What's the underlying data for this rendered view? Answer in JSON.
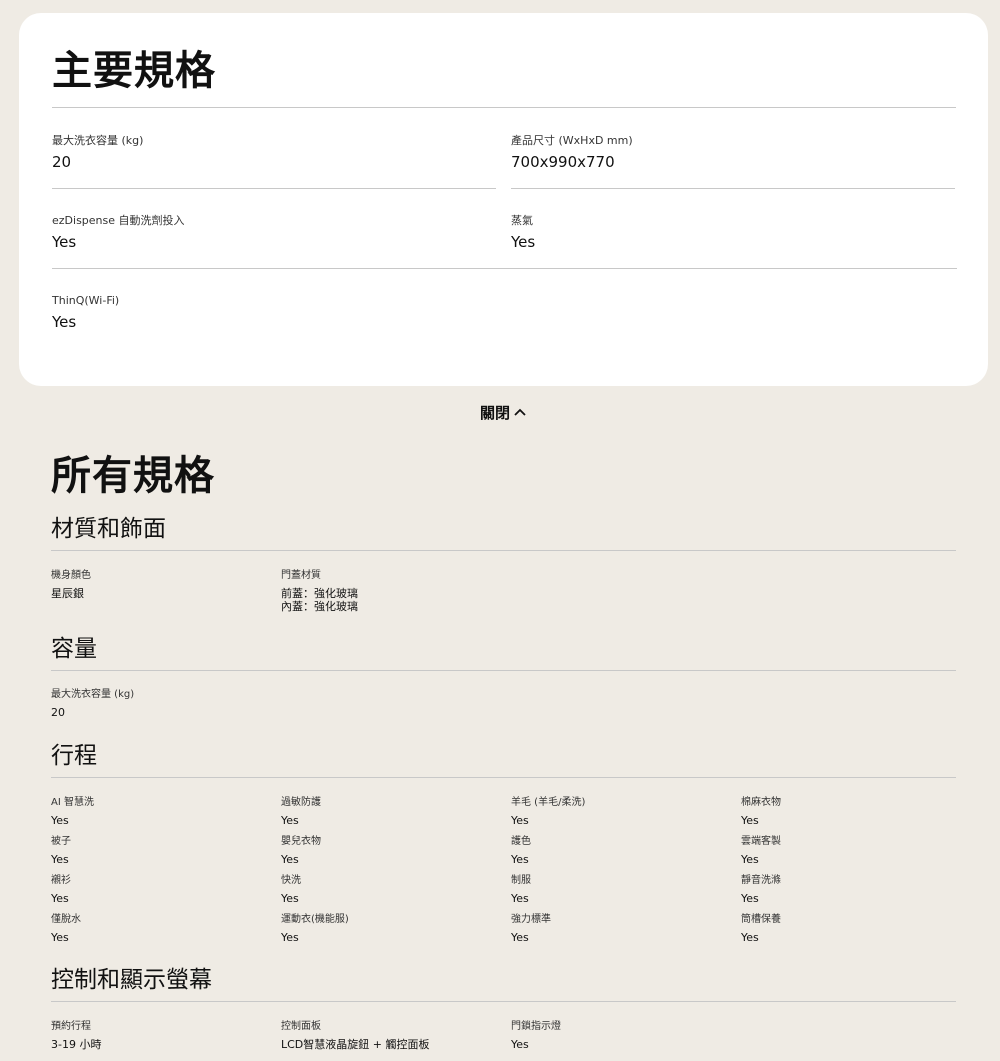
{
  "key_specs": {
    "title": "主要規格",
    "items": [
      {
        "label": "最大洗衣容量 (kg)",
        "value": "20"
      },
      {
        "label": "產品尺寸 (WxHxD mm)",
        "value": "700x990x770"
      },
      {
        "label": "ezDispense 自動洗劑投入",
        "value": "Yes"
      },
      {
        "label": "蒸氣",
        "value": "Yes"
      },
      {
        "label": "ThinQ(Wi-Fi)",
        "value": "Yes"
      }
    ]
  },
  "toggle": {
    "label": "關閉",
    "icon": "chevron-up-icon"
  },
  "all_specs": {
    "title": "所有規格",
    "sections": [
      {
        "title": "材質和飾面",
        "items": [
          {
            "label": "機身顏色",
            "value": "星辰銀"
          },
          {
            "label": "門蓋材質",
            "value": "前蓋：強化玻璃\n內蓋：強化玻璃"
          }
        ]
      },
      {
        "title": "容量",
        "items": [
          {
            "label": "最大洗衣容量 (kg)",
            "value": "20"
          }
        ]
      },
      {
        "title": "行程",
        "items": [
          {
            "label": "AI 智慧洗",
            "value": "Yes"
          },
          {
            "label": "過敏防護",
            "value": "Yes"
          },
          {
            "label": "羊毛 (羊毛/柔洗)",
            "value": "Yes"
          },
          {
            "label": "棉麻衣物",
            "value": "Yes"
          },
          {
            "label": "被子",
            "value": "Yes"
          },
          {
            "label": "嬰兒衣物",
            "value": "Yes"
          },
          {
            "label": "護色",
            "value": "Yes"
          },
          {
            "label": "雲端客製",
            "value": "Yes"
          },
          {
            "label": "襯衫",
            "value": "Yes"
          },
          {
            "label": "快洗",
            "value": "Yes"
          },
          {
            "label": "制服",
            "value": "Yes"
          },
          {
            "label": "靜音洗滌",
            "value": "Yes"
          },
          {
            "label": "僅脫水",
            "value": "Yes"
          },
          {
            "label": "運動衣(機能服)",
            "value": "Yes"
          },
          {
            "label": "強力標準",
            "value": "Yes"
          },
          {
            "label": "筒槽保養",
            "value": "Yes"
          }
        ]
      },
      {
        "title": "控制和顯示螢幕",
        "items": [
          {
            "label": "預約行程",
            "value": "3-19 小時"
          },
          {
            "label": "控制面板",
            "value": "LCD智慧液晶旋鈕 + 觸控面板"
          },
          {
            "label": "門鎖指示燈",
            "value": "Yes"
          }
        ]
      }
    ]
  }
}
